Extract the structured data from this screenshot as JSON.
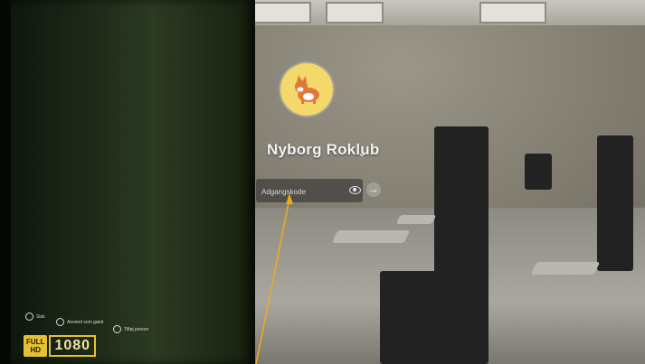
{
  "login": {
    "user_name": "Nyborg Roklub",
    "password_placeholder": "Adgangskode"
  },
  "bottom_actions": [
    {
      "label": "Sluk",
      "icon": "power-icon"
    },
    {
      "label": "Anvend som gæst",
      "icon": "guest-icon"
    },
    {
      "label": "Tilføj person",
      "icon": "add-person-icon"
    }
  ],
  "badge": {
    "top": "FULL",
    "mid": "HD",
    "resolution": "1080"
  },
  "colors": {
    "avatar_bg": "#f4d86a",
    "annotation_arrow": "#f0a820",
    "badge_yellow": "#e6c034"
  },
  "icons": {
    "avatar": "corgi-avatar-icon",
    "dropdown": "chevron-down-icon",
    "show_password": "eye-icon",
    "submit": "arrow-right-icon"
  }
}
